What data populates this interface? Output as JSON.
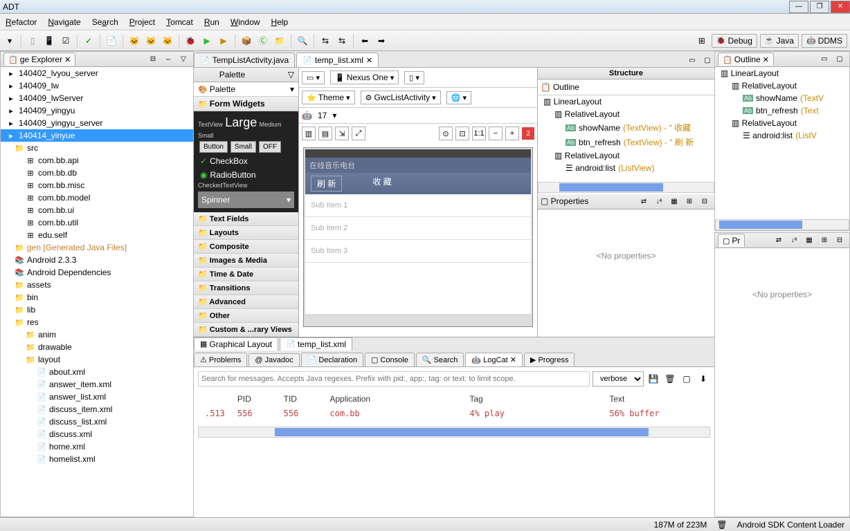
{
  "title": "ADT",
  "menu": [
    "Refactor",
    "Navigate",
    "Search",
    "Project",
    "Tomcat",
    "Run",
    "Window",
    "Help"
  ],
  "perspectives": {
    "debug": "Debug",
    "java": "Java",
    "ddms": "DDMS"
  },
  "package_explorer": {
    "title": "ge Explorer",
    "items": [
      {
        "label": "140402_lvyou_server",
        "icon": "project"
      },
      {
        "label": "140409_lw",
        "icon": "project"
      },
      {
        "label": "140409_lwServer",
        "icon": "project"
      },
      {
        "label": "140409_yingyu",
        "icon": "project"
      },
      {
        "label": "140409_yingyu_server",
        "icon": "project"
      },
      {
        "label": "140414_yinyue",
        "icon": "project",
        "selected": true
      },
      {
        "label": "src",
        "icon": "folder",
        "indent": 1
      },
      {
        "label": "com.bb.api",
        "icon": "package",
        "indent": 2
      },
      {
        "label": "com.bb.db",
        "icon": "package",
        "indent": 2
      },
      {
        "label": "com.bb.misc",
        "icon": "package",
        "indent": 2
      },
      {
        "label": "com.bb.model",
        "icon": "package",
        "indent": 2
      },
      {
        "label": "com.bb.ui",
        "icon": "package",
        "indent": 2
      },
      {
        "label": "com.bb.util",
        "icon": "package",
        "indent": 2
      },
      {
        "label": "edu.self",
        "icon": "package",
        "indent": 2
      },
      {
        "label": "gen [Generated Java Files]",
        "icon": "folder",
        "indent": 1,
        "color": "#c08030"
      },
      {
        "label": "Android 2.3.3",
        "icon": "lib",
        "indent": 1
      },
      {
        "label": "Android Dependencies",
        "icon": "lib",
        "indent": 1
      },
      {
        "label": "assets",
        "icon": "folder",
        "indent": 1
      },
      {
        "label": "bin",
        "icon": "folder",
        "indent": 1
      },
      {
        "label": "lib",
        "icon": "folder",
        "indent": 1
      },
      {
        "label": "res",
        "icon": "folder",
        "indent": 1
      },
      {
        "label": "anim",
        "icon": "folder",
        "indent": 2
      },
      {
        "label": "drawable",
        "icon": "folder",
        "indent": 2
      },
      {
        "label": "layout",
        "icon": "folder",
        "indent": 2
      },
      {
        "label": "about.xml",
        "icon": "xml",
        "indent": 3
      },
      {
        "label": "answer_item.xml",
        "icon": "xml",
        "indent": 3
      },
      {
        "label": "answer_list.xml",
        "icon": "xml",
        "indent": 3
      },
      {
        "label": "discuss_item.xml",
        "icon": "xml",
        "indent": 3
      },
      {
        "label": "discuss_list.xml",
        "icon": "xml",
        "indent": 3
      },
      {
        "label": "discuss.xml",
        "icon": "xml",
        "indent": 3
      },
      {
        "label": "home.xml",
        "icon": "xml",
        "indent": 3
      },
      {
        "label": "homelist.xml",
        "icon": "xml",
        "indent": 3
      }
    ]
  },
  "editor_tabs": [
    {
      "label": "TempListActivity.java",
      "icon": "java"
    },
    {
      "label": "temp_list.xml",
      "icon": "xml",
      "active": true
    }
  ],
  "palette": {
    "title": "Palette",
    "dropdown": "Palette",
    "categories": [
      "Form Widgets"
    ],
    "preview": {
      "textview": "TextView",
      "large": "Large",
      "medium": "Medium",
      "small": "Small",
      "button": "Button",
      "small_btn": "Small",
      "off": "OFF",
      "checkbox": "CheckBox",
      "radio": "RadioButton",
      "checkedtv": "CheckedTextView",
      "spinner": "Spinner"
    },
    "cats": [
      "Text Fields",
      "Layouts",
      "Composite",
      "Images & Media",
      "Time & Date",
      "Transitions",
      "Advanced",
      "Other",
      "Custom & ...rary Views"
    ]
  },
  "canvas": {
    "device": "Nexus One",
    "theme": "Theme",
    "activity": "GwcListActivity",
    "api": "17",
    "lint_count": "2",
    "app_title": "在线音乐电台",
    "refresh": "刷 新",
    "collect": "收 藏",
    "items": [
      "Sub Item 1",
      "Sub Item 2",
      "Sub Item 3"
    ]
  },
  "footer_tabs": {
    "graphical": "Graphical Layout",
    "xml": "temp_list.xml"
  },
  "structure": {
    "title": "Structure",
    "outline_label": "Outline",
    "items": [
      {
        "label": "LinearLayout",
        "indent": 0
      },
      {
        "label": "RelativeLayout",
        "indent": 1
      },
      {
        "label": "showName (TextView) - \" 收藏",
        "indent": 2,
        "icon": "ab"
      },
      {
        "label": "btn_refresh (TextView) - \" 刷 新",
        "indent": 2,
        "icon": "ab"
      },
      {
        "label": "RelativeLayout",
        "indent": 1
      },
      {
        "label": "android:list (ListView)",
        "indent": 2,
        "icon": "list"
      }
    ]
  },
  "properties": {
    "title": "Properties",
    "empty": "<No properties>"
  },
  "outline_right": {
    "title": "Outline",
    "items": [
      {
        "label": "LinearLayout",
        "indent": 0
      },
      {
        "label": "RelativeLayout",
        "indent": 1
      },
      {
        "label": "showName (TextV",
        "indent": 2,
        "icon": "ab"
      },
      {
        "label": "btn_refresh (Text",
        "indent": 2,
        "icon": "ab"
      },
      {
        "label": "RelativeLayout",
        "indent": 1
      },
      {
        "label": "android:list (ListV",
        "indent": 2,
        "icon": "list"
      }
    ]
  },
  "pr_panel": {
    "title": "Pr",
    "empty": "<No properties>"
  },
  "bottom_tabs": [
    {
      "label": "Problems",
      "icon": "⚠"
    },
    {
      "label": "Javadoc",
      "icon": "@"
    },
    {
      "label": "Declaration",
      "icon": "📄"
    },
    {
      "label": "Console",
      "icon": "▢"
    },
    {
      "label": "Search",
      "icon": "🔍"
    },
    {
      "label": "LogCat",
      "icon": "🤖",
      "active": true
    },
    {
      "label": "Progress",
      "icon": "▶"
    }
  ],
  "logcat": {
    "search_placeholder": "Search for messages. Accepts Java regexes. Prefix with pid:, app:, tag: or text: to limit scope.",
    "level": "verbose",
    "headers": [
      "PID",
      "TID",
      "Application",
      "Tag",
      "Text"
    ],
    "rows": [
      {
        "time": ".513",
        "pid": "556",
        "tid": "556",
        "app": "com.bb",
        "tag": "4% play",
        "text": "56% buffer"
      }
    ]
  },
  "statusbar": {
    "memory": "187M of 223M",
    "loader": "Android SDK Content Loader"
  }
}
